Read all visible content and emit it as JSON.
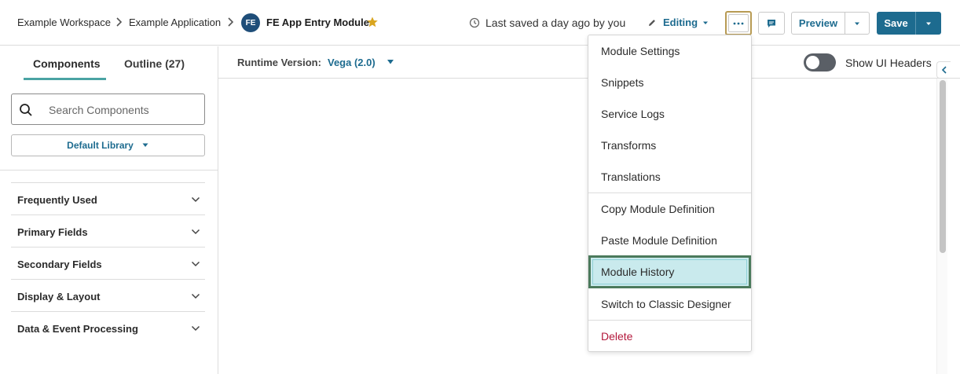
{
  "header": {
    "breadcrumbs": [
      "Example Workspace",
      "Example Application"
    ],
    "avatar_initials": "FE",
    "module_title": "FE App Entry Module",
    "saved_status": "Last saved a day ago by you",
    "mode_label": "Editing",
    "preview_label": "Preview",
    "save_label": "Save"
  },
  "sidebar": {
    "tabs": [
      {
        "label": "Components",
        "active": true
      },
      {
        "label": "Outline (27)",
        "active": false
      }
    ],
    "search_placeholder": "Search Components",
    "library_label": "Default Library",
    "sections": [
      "Frequently Used",
      "Primary Fields",
      "Secondary Fields",
      "Display & Layout",
      "Data & Event Processing"
    ]
  },
  "runtime": {
    "label": "Runtime Version:",
    "value": "Vega (2.0)",
    "toggle_label": "Show UI Headers",
    "toggle_on": false
  },
  "menu": {
    "items": [
      {
        "label": "Module Settings"
      },
      {
        "label": "Snippets"
      },
      {
        "label": "Service Logs"
      },
      {
        "label": "Transforms"
      },
      {
        "label": "Translations"
      },
      {
        "label": "Copy Module Definition"
      },
      {
        "label": "Paste Module Definition"
      },
      {
        "label": "Module History",
        "highlighted": true
      },
      {
        "label": "Switch to Classic Designer"
      },
      {
        "label": "Delete",
        "danger": true
      }
    ]
  },
  "colors": {
    "accent": "#1d6b8f",
    "tab_underline": "#4aa3a3",
    "highlight_bg": "#c9eaed",
    "highlight_border": "#4b7a5c",
    "danger": "#b3183b",
    "star": "#d9a520"
  }
}
